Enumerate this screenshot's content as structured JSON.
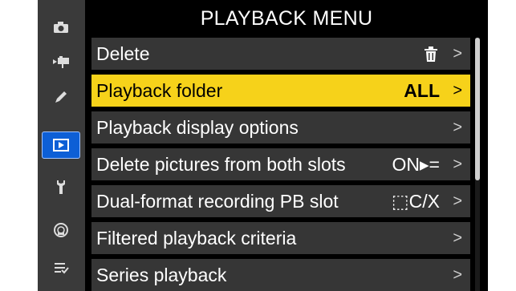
{
  "title": "PLAYBACK MENU",
  "sidebar": {
    "items": [
      {
        "icon": "camera-icon"
      },
      {
        "icon": "movie-camera-icon"
      },
      {
        "icon": "pencil-icon"
      },
      {
        "icon": "playback-icon",
        "active": true
      },
      {
        "icon": "wrench-icon"
      },
      {
        "icon": "network-icon"
      },
      {
        "icon": "my-menu-icon"
      }
    ]
  },
  "menu": {
    "items": [
      {
        "label": "Delete",
        "value_icon": "trash-icon"
      },
      {
        "label": "Playback folder",
        "value": "ALL",
        "selected": true
      },
      {
        "label": "Playback display options",
        "value": ""
      },
      {
        "label": "Delete pictures from both slots",
        "value": "ON▸="
      },
      {
        "label": "Dual-format recording PB slot",
        "value": "⬚C/X"
      },
      {
        "label": "Filtered playback criteria",
        "value": ""
      },
      {
        "label": "Series playback",
        "value": ""
      }
    ],
    "chevron": ">"
  },
  "colors": {
    "highlight": "#f6d21a",
    "active_tab": "#0d5fd6",
    "row_bg": "#363636",
    "sidebar_bg": "#3a3a3a"
  }
}
